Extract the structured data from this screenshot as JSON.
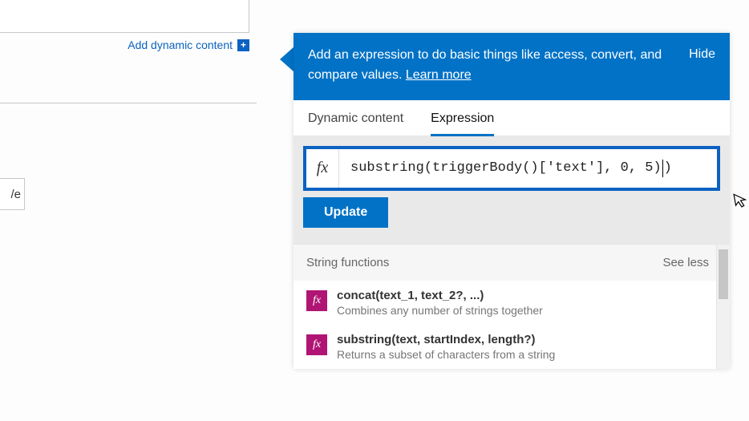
{
  "left": {
    "add_dynamic_label": "Add dynamic content",
    "save_fragment": "/e"
  },
  "banner": {
    "text_before_link": "Add an expression to do basic things like access, convert, and compare values. ",
    "link_text": "Learn more",
    "hide_label": "Hide"
  },
  "tabs": {
    "tab1": "Dynamic content",
    "tab2": "Expression",
    "active_index": 1
  },
  "expression": {
    "fx_label": "fx",
    "value_before_caret": "substring(triggerBody()['text'], 0, 5)",
    "value_after_caret": ")",
    "update_label": "Update"
  },
  "section": {
    "title": "String functions",
    "collapse_label": "See less"
  },
  "functions": [
    {
      "sig": "concat(text_1, text_2?, ...)",
      "desc": "Combines any number of strings together"
    },
    {
      "sig": "substring(text, startIndex, length?)",
      "desc": "Returns a subset of characters from a string"
    }
  ],
  "colors": {
    "accent": "#0172c6",
    "fx_badge": "#b01573"
  }
}
